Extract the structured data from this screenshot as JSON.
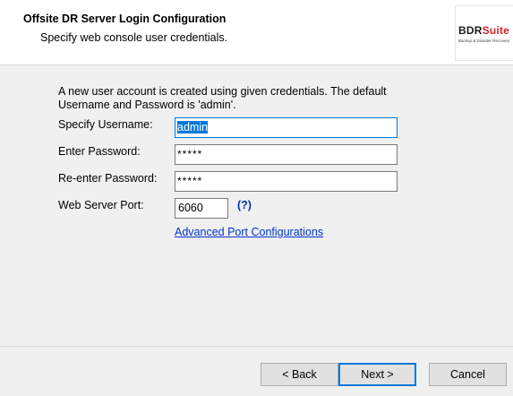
{
  "header": {
    "title": "Offsite DR Server Login Configuration",
    "subtitle": "Specify web console user credentials.",
    "logo": {
      "bdr": "BDR",
      "suite": "Suite",
      "tagline": "Backup & Disaster Recovery"
    }
  },
  "form": {
    "intro": "A new user account is created using given credentials. The default Username and Password is 'admin'.",
    "username_label": "Specify Username:",
    "username_value": "admin",
    "password_label": "Enter Password:",
    "password_value": "*****",
    "reenter_label": "Re-enter Password:",
    "reenter_value": "*****",
    "port_label": "Web Server Port:",
    "port_value": "6060",
    "help_link": "(?)",
    "advanced_link": "Advanced Port Configurations"
  },
  "buttons": {
    "back": "< Back",
    "next": "Next >",
    "cancel": "Cancel"
  },
  "colors": {
    "accent": "#0078d7",
    "link": "#0033cc",
    "brand_red": "#d2232a"
  }
}
